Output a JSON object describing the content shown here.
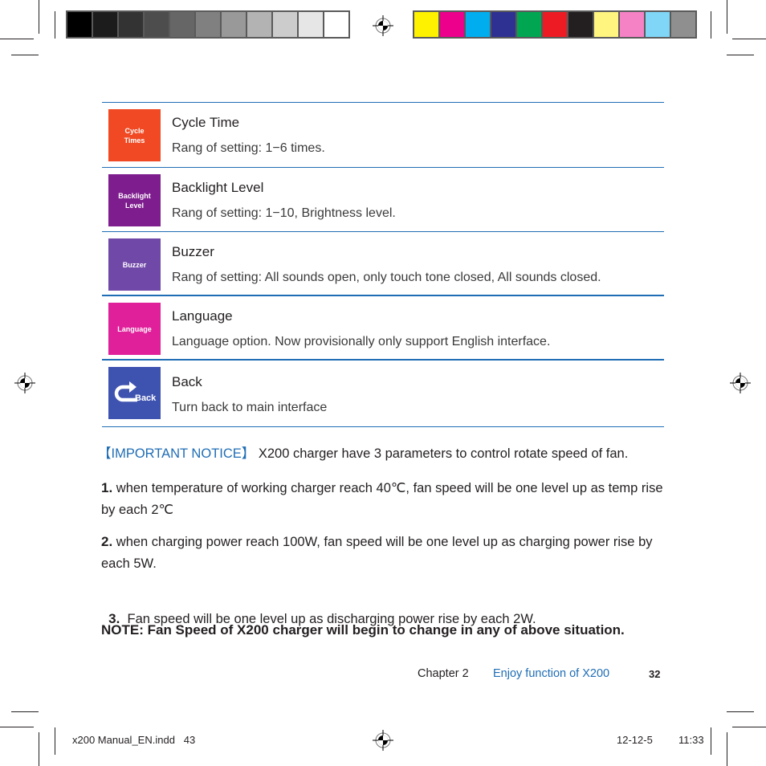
{
  "print_marks": {
    "grayscale_swatches": [
      "#000000",
      "#1c1c1c",
      "#333333",
      "#4d4d4d",
      "#666666",
      "#808080",
      "#999999",
      "#b3b3b3",
      "#cccccc",
      "#e6e6e6",
      "#ffffff"
    ],
    "color_swatches": [
      "#fff200",
      "#ec008c",
      "#00aeef",
      "#2e3192",
      "#00a651",
      "#ed1c24",
      "#231f20",
      "#fff57f",
      "#f682c6",
      "#7fd6f7",
      "#8f8f8f"
    ]
  },
  "settings": [
    {
      "tile_label_1": "Cycle",
      "tile_label_2": "Times",
      "tile_color": "#f04923",
      "title": "Cycle Time",
      "desc": "Rang of setting: 1−6 times."
    },
    {
      "tile_label_1": "Backlight",
      "tile_label_2": "Level",
      "tile_color": "#7e1d8e",
      "title": "Backlight Level",
      "desc": "Rang of setting: 1−10, Brightness level."
    },
    {
      "tile_label_1": "Buzzer",
      "tile_label_2": "",
      "tile_color": "#7048a8",
      "title": "Buzzer",
      "desc": "Rang of setting: All sounds open, only touch tone closed, All sounds closed."
    },
    {
      "tile_label_1": "Language",
      "tile_label_2": "",
      "tile_color": "#e0209a",
      "title": "Language",
      "desc": "Language option. Now provisionally only support English interface."
    },
    {
      "tile_label_1": "Back",
      "tile_label_2": "",
      "tile_color": "#3e52b0",
      "title": "Back",
      "desc": "Turn back to main interface",
      "icon": "back-arrow-icon"
    }
  ],
  "notice": {
    "label": "【IMPORTANT NOTICE】",
    "text": "X200 charger have 3 parameters to control rotate speed of fan.",
    "items": [
      {
        "num": "1.",
        "text": " when temperature of working charger reach 40℃, fan speed will be one level up as temp rise by each 2℃"
      },
      {
        "num": "2.",
        "text": " when charging power reach 100W, fan speed will be one level up as charging power rise by each 5W."
      },
      {
        "num": "3.",
        "text": "  Fan speed will be one level up as discharging power rise by each 2W."
      }
    ],
    "note": "NOTE: Fan Speed of X200 charger will begin to change in any of above situation."
  },
  "footer": {
    "chapter": "Chapter 2",
    "section": "Enjoy function of X200",
    "page": "32"
  },
  "slug": {
    "file": "x200 Manual_EN.indd   43",
    "date": "12-12-5",
    "time": "11:33"
  }
}
